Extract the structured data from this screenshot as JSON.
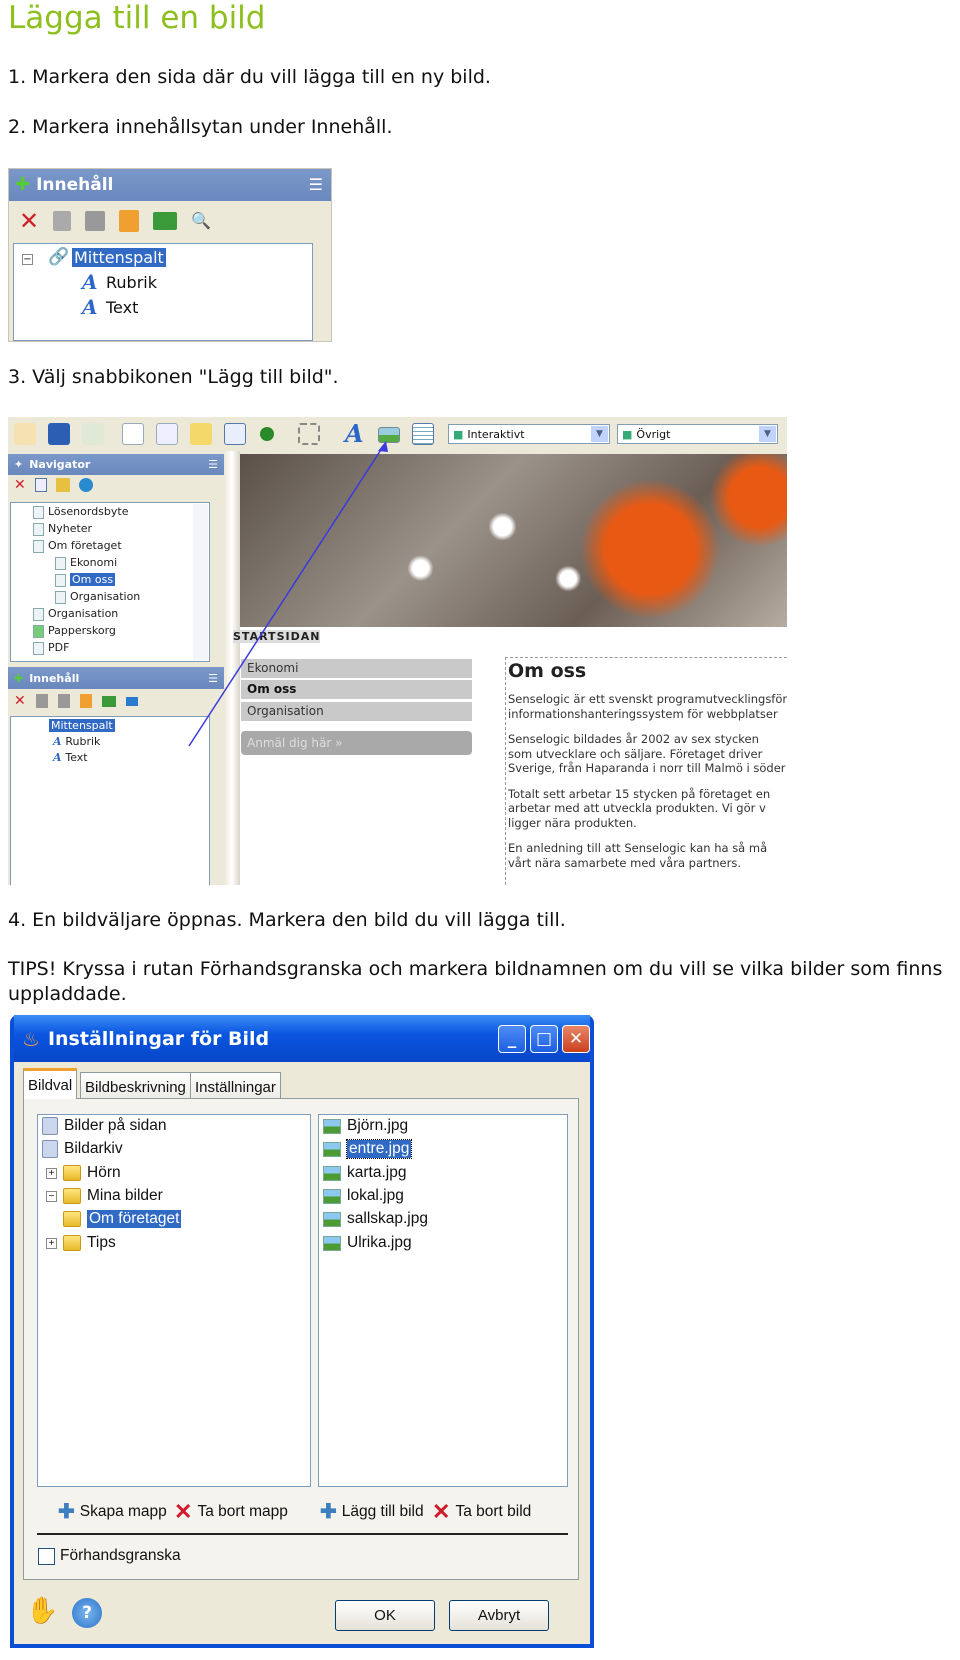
{
  "title": "Lägga till en bild",
  "steps": {
    "s1": "1. Markera den sida där du vill lägga till en ny bild.",
    "s2": "2. Markera innehållsytan under Innehåll.",
    "s3": "3. Välj snabbikonen \"Lägg till bild\".",
    "s4": "4. En bildväljare öppnas. Markera den bild du vill lägga till.",
    "tips1": "TIPS! Kryssa i rutan Förhandsgranska och markera bildnamnen om du vill se vilka bilder som finns",
    "tips2": "uppladdade."
  },
  "content_panel": {
    "header": "Innehåll",
    "tree": [
      "Mittenspalt",
      "Rubrik",
      "Text"
    ]
  },
  "editor": {
    "dropdowns": [
      "Interaktivt",
      "Övrigt"
    ],
    "navigator": {
      "header": "Navigator",
      "tree": [
        "Lösenordsbyte",
        "Nyheter",
        "Om företaget",
        "Ekonomi",
        "Om oss",
        "Organisation",
        "Organisation",
        "Papperskorg",
        "PDF"
      ],
      "selected": "Om oss"
    },
    "content": {
      "header": "Innehåll",
      "tree": [
        "Mittenspalt",
        "Rubrik",
        "Text"
      ]
    },
    "page": {
      "breadcrumb": "STARTSIDAN",
      "menu": [
        "Ekonomi",
        "Om oss",
        "Organisation"
      ],
      "signup": "Anmäl dig här »",
      "heading": "Om oss",
      "lines": [
        "Senselogic är ett svenskt programutvecklingsföretag",
        "informationshanteringssystem för webbplatser",
        "Senselogic bildades år 2002 av sex stycken",
        "som utvecklare och säljare. Företaget driver",
        "Sverige, från Haparanda i norr till Malmö i söder",
        "Totalt sett arbetar 15 stycken på företaget en",
        "arbetar med att utveckla produkten. Vi gör v",
        "ligger nära produkten.",
        "En anledning till att Senselogic kan ha så må",
        "vårt nära samarbete med våra partners."
      ]
    }
  },
  "dialog": {
    "title": "Inställningar för Bild",
    "tabs": [
      "Bildval",
      "Bildbeskrivning",
      "Inställningar"
    ],
    "folders": [
      "Bilder på sidan",
      "Bildarkiv",
      "Hörn",
      "Mina bilder",
      "Om företaget",
      "Tips"
    ],
    "selected_folder": "Om företaget",
    "files": [
      "Björn.jpg",
      "entre.jpg",
      "karta.jpg",
      "lokal.jpg",
      "sallskap.jpg",
      "Ulrika.jpg"
    ],
    "selected_file": "entre.jpg",
    "actions": [
      "Skapa mapp",
      "Ta bort mapp",
      "Lägg till bild",
      "Ta bort bild"
    ],
    "preview_label": "Förhandsgranska",
    "preview_checked": false,
    "ok": "OK",
    "cancel": "Avbryt"
  }
}
